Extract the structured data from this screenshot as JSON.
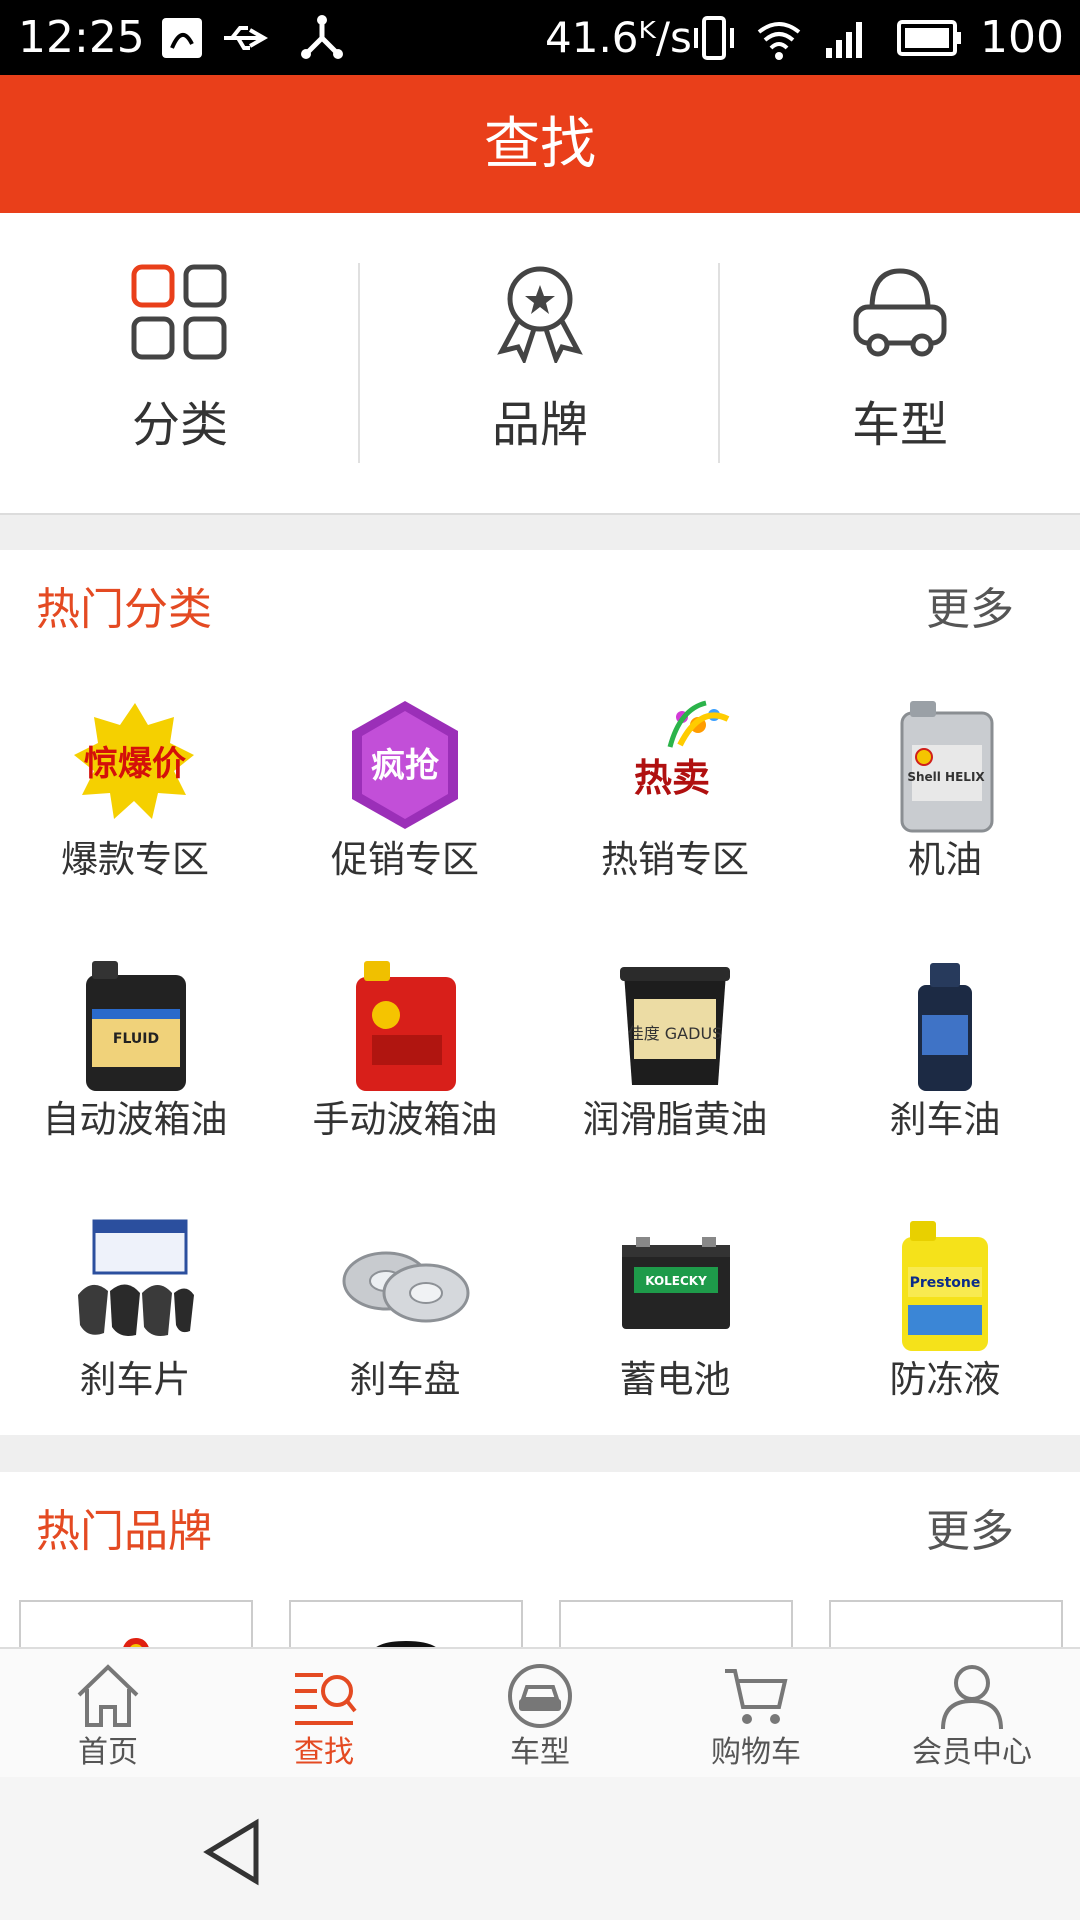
{
  "status_bar": {
    "time": "12:25",
    "speed": "41.6ᴷ/s",
    "battery": "100"
  },
  "header": {
    "title": "查找"
  },
  "filters": [
    {
      "label": "分类",
      "icon": "grid-icon"
    },
    {
      "label": "品牌",
      "icon": "award-ribbon-icon"
    },
    {
      "label": "车型",
      "icon": "car-icon"
    }
  ],
  "hot_categories": {
    "title": "热门分类",
    "more": "更多",
    "items": [
      {
        "label": "爆款专区"
      },
      {
        "label": "促销专区"
      },
      {
        "label": "热销专区"
      },
      {
        "label": "机油"
      },
      {
        "label": "自动波箱油"
      },
      {
        "label": "手动波箱油"
      },
      {
        "label": "润滑脂黄油"
      },
      {
        "label": "刹车油"
      },
      {
        "label": "刹车片"
      },
      {
        "label": "刹车盘"
      },
      {
        "label": "蓄电池"
      },
      {
        "label": "防冻液"
      }
    ],
    "images": {
      "promo1": "惊爆价",
      "promo2": "疯抢",
      "promo3": "热卖",
      "oil_brand": "Shell HELIX",
      "atf": "FLUID",
      "grease": "佳度 GADUS",
      "battery": "KOLECKY",
      "coolant": "Prestone"
    }
  },
  "hot_brands": {
    "title": "热门品牌",
    "more": "更多"
  },
  "tabbar": [
    {
      "label": "首页",
      "icon": "home-icon",
      "active": false
    },
    {
      "label": "查找",
      "icon": "search-list-icon",
      "active": true
    },
    {
      "label": "车型",
      "icon": "car-icon",
      "active": false
    },
    {
      "label": "购物车",
      "icon": "cart-icon",
      "active": false
    },
    {
      "label": "会员中心",
      "icon": "user-icon",
      "active": false
    }
  ],
  "colors": {
    "accent": "#e93f1a",
    "accent_text": "#e44a22"
  }
}
